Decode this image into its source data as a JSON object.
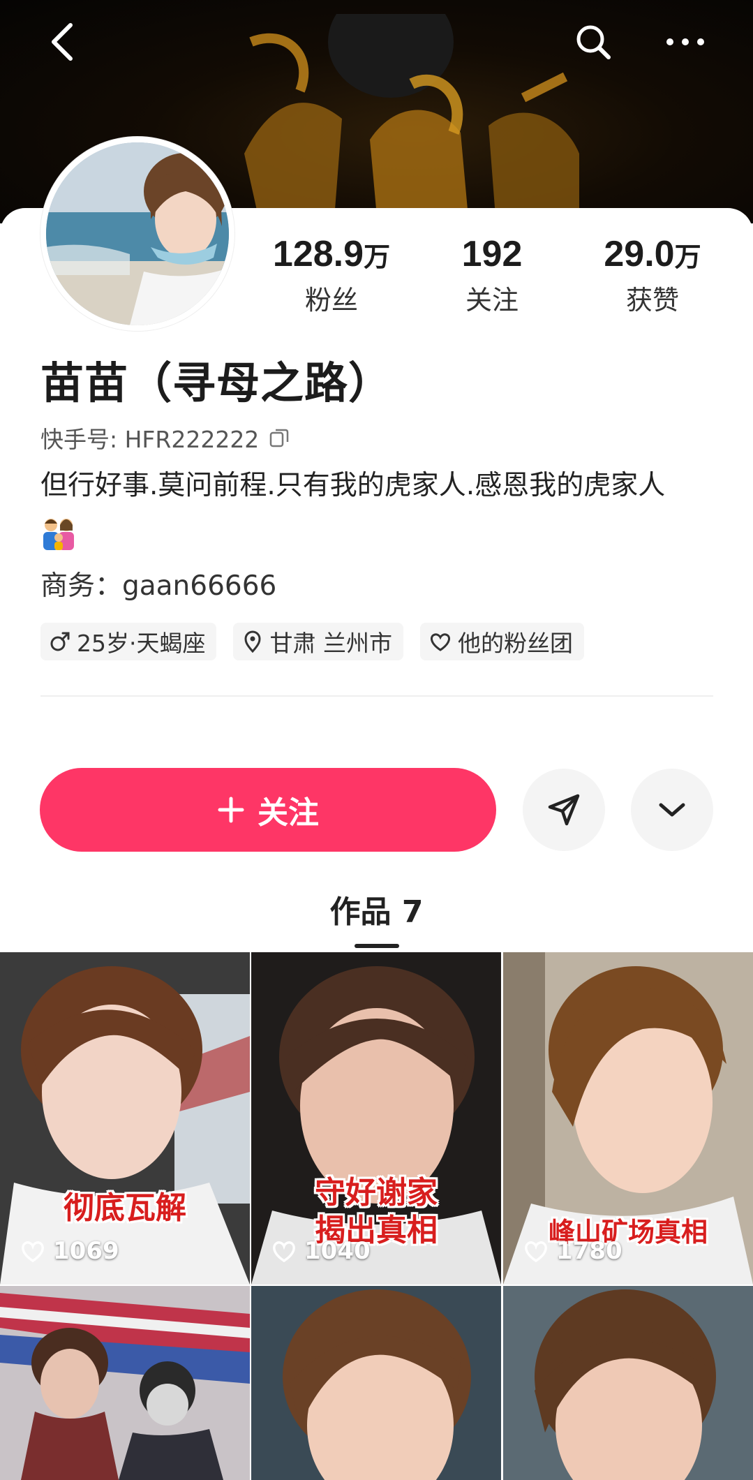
{
  "colors": {
    "accent": "#fe3666",
    "tag_bg": "#f5f5f5"
  },
  "nav": {
    "back_icon": "chevron-left-icon",
    "search_icon": "search-icon",
    "more_icon": "more-horizontal-icon"
  },
  "stats": [
    {
      "value": "128.9",
      "unit": "万",
      "label": "粉丝"
    },
    {
      "value": "192",
      "unit": "",
      "label": "关注"
    },
    {
      "value": "29.0",
      "unit": "万",
      "label": "获赞"
    }
  ],
  "profile": {
    "name": "苗苗（寻母之路）",
    "kuaishou_id": "快手号: HFR222222",
    "bio": "但行好事.莫问前程.只有我的虎家人.感恩我的虎家人",
    "business": "商务：gaan66666"
  },
  "tags": [
    {
      "icon": "male-icon",
      "label": "25岁·天蝎座"
    },
    {
      "icon": "location-icon",
      "label": "甘肃 兰州市"
    },
    {
      "icon": "heart-icon",
      "label": "他的粉丝团"
    }
  ],
  "actions": {
    "follow_label": "关注",
    "share_icon": "send-icon",
    "expand_icon": "chevron-down-icon"
  },
  "tabs": {
    "works_label": "作品 7"
  },
  "videos": [
    {
      "caption": "彻底瓦解",
      "likes": "1069"
    },
    {
      "caption": "守好谢家\n揭出真相",
      "likes": "1040"
    },
    {
      "caption": "峰山矿场真相",
      "likes": "1780"
    },
    {
      "caption": "",
      "likes": ""
    },
    {
      "caption": "",
      "likes": ""
    },
    {
      "caption": "",
      "likes": ""
    }
  ]
}
